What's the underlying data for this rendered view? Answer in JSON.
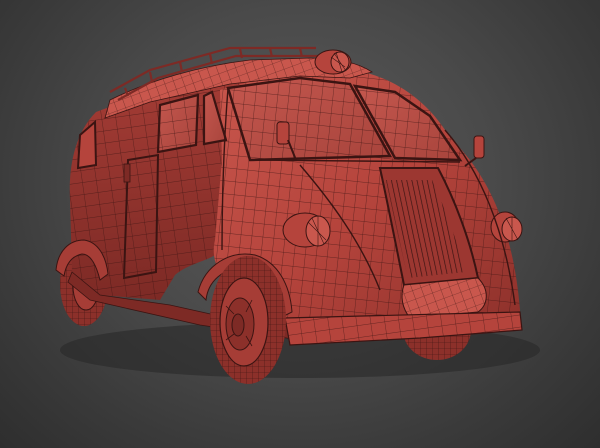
{
  "scene": {
    "subject": "wireframe-van-model",
    "colors": {
      "body": "#b5443c",
      "body_shadow": "#7d2a25",
      "body_highlight": "#cf5a50",
      "wire": "#3b1412",
      "background_center": "#5a5a5a",
      "background_edge": "#2e2e2e"
    }
  }
}
